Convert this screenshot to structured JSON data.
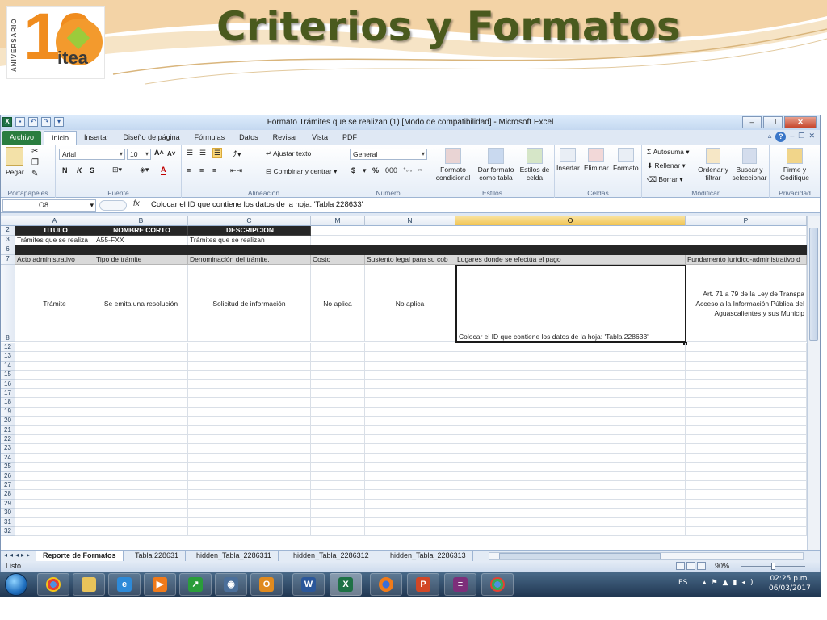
{
  "slide": {
    "title": "Criterios y Formatos",
    "logo_text": "itea",
    "logo_number": "10",
    "logo_aniv": "ANIVERSARIO"
  },
  "window": {
    "title": "Formato Trámites que se realizan (1)  [Modo de compatibilidad] - Microsoft Excel"
  },
  "tabs": [
    "Archivo",
    "Inicio",
    "Insertar",
    "Diseño de página",
    "Fórmulas",
    "Datos",
    "Revisar",
    "Vista",
    "PDF"
  ],
  "ribbon": {
    "portapapeles": {
      "label": "Portapapeles",
      "pegar": "Pegar"
    },
    "fuente": {
      "label": "Fuente",
      "font": "Arial",
      "size": "10",
      "bold": "N",
      "italic": "K",
      "underline": "S"
    },
    "alineacion": {
      "label": "Alineación",
      "wrap": "Ajustar texto",
      "merge": "Combinar y centrar"
    },
    "numero": {
      "label": "Número",
      "format": "General",
      "currency": "$",
      "percent": "%",
      "thousands": "000"
    },
    "estilos": {
      "label": "Estilos",
      "cond": "Formato condicional",
      "table": "Dar formato como tabla",
      "cell": "Estilos de celda"
    },
    "celdas": {
      "label": "Celdas",
      "insert": "Insertar",
      "delete": "Eliminar",
      "format": "Formato"
    },
    "modificar": {
      "label": "Modificar",
      "autosum": "Autosuma",
      "fill": "Rellenar",
      "clear": "Borrar",
      "sort": "Ordenar y filtrar",
      "find": "Buscar y seleccionar"
    },
    "privacidad": {
      "label": "Privacidad",
      "sign": "Firme y Codifique"
    }
  },
  "formula_bar": {
    "namebox": "O8",
    "fx": "fx",
    "formula": "Colocar el ID que contiene los datos de la hoja: 'Tabla 228633'"
  },
  "columns": [
    "A",
    "B",
    "C",
    "M",
    "N",
    "O",
    "P"
  ],
  "row_numbers": [
    "2",
    "3",
    "6",
    "7",
    "8",
    "12",
    "13",
    "14",
    "15",
    "16",
    "17",
    "18",
    "19",
    "20",
    "21",
    "22",
    "23",
    "24",
    "25",
    "26",
    "27",
    "28",
    "29",
    "30",
    "31",
    "32"
  ],
  "rows": {
    "r2": [
      "TITULO",
      "NOMBRE CORTO",
      "DESCRIPCION"
    ],
    "r3": [
      "Trámites que se realiza",
      "A55-FXX",
      "Trámites que se realizan"
    ],
    "r7": [
      "Acto administrativo",
      "Tipo de trámite",
      "Denominación del trámite.",
      "Costo",
      "Sustento legal para su cob",
      "Lugares donde se efectúa el pago",
      "Fundamento jurídico-administrativo d"
    ],
    "r8": [
      "Trámite",
      "Se emita una resolución",
      "Solicitud de información",
      "No aplica",
      "No aplica",
      "Colocar el ID que contiene los datos de la hoja: 'Tabla 228633'",
      "Art. 71 a 79 de la Ley de Transpa Acceso a la Información Pública del Aguascalientes y sus Municip"
    ]
  },
  "sheets": [
    "Reporte de Formatos",
    "Tabla 228631",
    "hidden_Tabla_2286311",
    "hidden_Tabla_2286312",
    "hidden_Tabla_2286313"
  ],
  "status": {
    "left": "Listo",
    "zoom": "90%"
  },
  "taskbar": {
    "lang": "ES",
    "time": "02:25 p.m.",
    "date": "06/03/2017"
  }
}
